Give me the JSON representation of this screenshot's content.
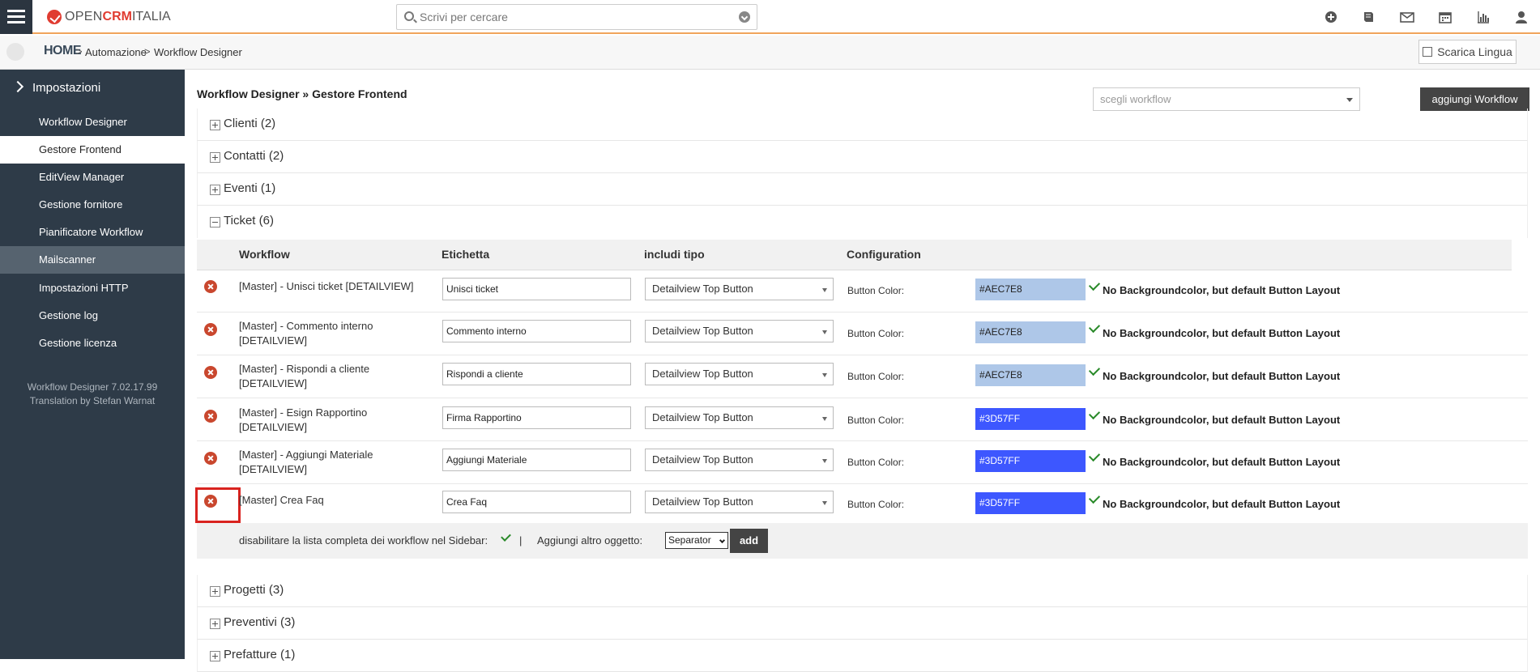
{
  "app": {
    "logo_part1": "OPEN",
    "logo_part2": "CRM",
    "logo_part3": "ITALIA"
  },
  "search": {
    "placeholder": "Scrivi per cercare"
  },
  "breadcrumb": {
    "home": "HOME",
    "sep": ">",
    "items": [
      "Automazione",
      "Workflow Designer"
    ]
  },
  "download_button": "Scarica Lingua",
  "sidebar": {
    "header": "Impostazioni",
    "items": [
      {
        "label": "Workflow Designer"
      },
      {
        "label": "Gestore Frontend"
      },
      {
        "label": "EditView Manager"
      },
      {
        "label": "Gestione fornitore"
      },
      {
        "label": "Pianificatore Workflow"
      },
      {
        "label": "Mailscanner"
      },
      {
        "label": "Impostazioni HTTP"
      },
      {
        "label": "Gestione log"
      },
      {
        "label": "Gestione licenza"
      }
    ],
    "active_item": "Gestore Frontend",
    "highlighted_item": "Mailscanner",
    "footer_line1": "Workflow Designer 7.02.17.99",
    "footer_line2": "Translation by Stefan Warnat"
  },
  "main": {
    "title": "Workflow Designer » Gestore Frontend",
    "workflow_select_placeholder": "scegli workflow",
    "add_workflow_button": "aggiungi Workflow",
    "groups_before": [
      {
        "label": "Clienti (2)"
      },
      {
        "label": "Contatti (2)"
      },
      {
        "label": "Eventi (1)"
      },
      {
        "label": "Ticket (6)"
      }
    ],
    "table": {
      "headers": [
        "Workflow",
        "Etichetta",
        "includi tipo",
        "Configuration"
      ],
      "button_color_label": "Button Color:",
      "no_bg_text": "No Backgroundcolor, but default Button Layout",
      "rows": [
        {
          "workflow": "[Master] - Unisci ticket [DETAILVIEW]",
          "label": "Unisci ticket",
          "type": "Detailview Top Button",
          "color": "#AEC7E8"
        },
        {
          "workflow": "[Master] - Commento interno [DETAILVIEW]",
          "label": "Commento interno",
          "type": "Detailview Top Button",
          "color": "#AEC7E8"
        },
        {
          "workflow": "[Master] - Rispondi a cliente [DETAILVIEW]",
          "label": "Rispondi a cliente",
          "type": "Detailview Top Button",
          "color": "#AEC7E8"
        },
        {
          "workflow": "[Master] - Esign Rapportino [DETAILVIEW]",
          "label": "Firma Rapportino",
          "type": "Detailview Top Button",
          "color": "#3D57FF"
        },
        {
          "workflow": "[Master] - Aggiungi Materiale [DETAILVIEW]",
          "label": "Aggiungi Materiale",
          "type": "Detailview Top Button",
          "color": "#3D57FF"
        },
        {
          "workflow": "[Master] Crea Faq",
          "label": "Crea Faq",
          "type": "Detailview Top Button",
          "color": "#3D57FF"
        }
      ]
    },
    "footer": {
      "disable_text": "disabilitare la lista completa dei workflow nel Sidebar:",
      "divider": "|",
      "add_other_label": "Aggiungi altro oggetto:",
      "separator_option": "Separator",
      "add_button": "add"
    },
    "groups_after": [
      {
        "label": "Progetti (3)"
      },
      {
        "label": "Preventivi (3)"
      },
      {
        "label": "Prefatture (1)"
      }
    ]
  },
  "colors": {
    "sidebar_bg": "#2e3b48",
    "accent_orange": "#f0a45c",
    "light_blue": "#AEC7E8",
    "strong_blue": "#3D57FF",
    "delete_red": "#c9472e",
    "check_green": "#2a8a2a"
  },
  "icons": [
    "menu-icon",
    "search-icon",
    "add-circle-icon",
    "book-icon",
    "mail-icon",
    "calendar-icon",
    "bar-chart-icon",
    "user-icon"
  ]
}
